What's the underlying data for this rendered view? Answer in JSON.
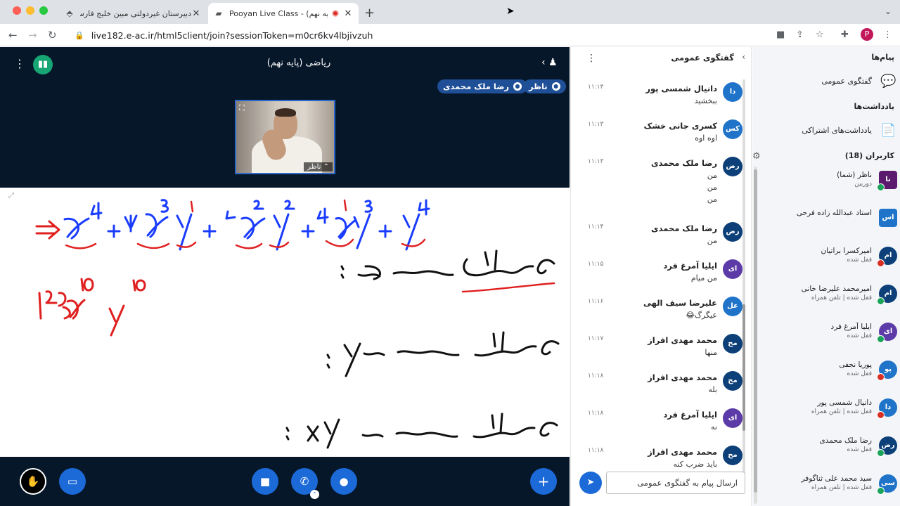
{
  "browser": {
    "tabs": [
      {
        "title": "دبیرستان غیردولتی مبین خلیج فارس",
        "active": false
      },
      {
        "title": "Pooyan Live Class - (پایه نهم)",
        "active": true
      }
    ],
    "url": "live182.e-ac.ir/html5client/join?sessionToken=m0cr6kv4lbjivzuh",
    "profile_initial": "P"
  },
  "stage": {
    "meeting_title": "ریاضی (پایه نهم)",
    "talkers": [
      "ناظر",
      "رضا ملک محمدی"
    ],
    "webcam_name": "ناظر"
  },
  "chat": {
    "title": "گفتگوی عمومی",
    "input_placeholder": "ارسال پیام به گفتگوی عمومی",
    "messages": [
      {
        "initials": "دا",
        "sender": "دانیال شمسی پور",
        "time": "۱۱:۱۳",
        "lines": [
          "ببخشید"
        ],
        "color": "#1f73c9"
      },
      {
        "initials": "کس",
        "sender": "کسری جانی خشک",
        "time": "۱۱:۱۳",
        "lines": [
          "اوه اوه"
        ],
        "color": "#1f73c9"
      },
      {
        "initials": "رض",
        "sender": "رضا ملک محمدی",
        "time": "۱۱:۱۳",
        "lines": [
          "من",
          "من",
          "من"
        ],
        "color": "#0d3f78"
      },
      {
        "initials": "رض",
        "sender": "رضا ملک محمدی",
        "time": "۱۱:۱۴",
        "lines": [
          "من"
        ],
        "color": "#0d3f78"
      },
      {
        "initials": "ای",
        "sender": "ایلیا آمرغ فرد",
        "time": "۱۱:۱۵",
        "lines": [
          "من میام"
        ],
        "color": "#5c3aa8"
      },
      {
        "initials": "عل",
        "sender": "علیرضا سیف الهی",
        "time": "۱۱:۱۶",
        "lines": [
          "عیگرگ😂"
        ],
        "color": "#1f73c9"
      },
      {
        "initials": "مح",
        "sender": "محمد مهدی افراز",
        "time": "۱۱:۱۷",
        "lines": [
          "منها"
        ],
        "color": "#0d3f78"
      },
      {
        "initials": "مح",
        "sender": "محمد مهدی افراز",
        "time": "۱۱:۱۸",
        "lines": [
          "بله"
        ],
        "color": "#0d3f78"
      },
      {
        "initials": "ای",
        "sender": "ایلیا آمرغ فرد",
        "time": "۱۱:۱۸",
        "lines": [
          "نه"
        ],
        "color": "#5c3aa8"
      },
      {
        "initials": "مح",
        "sender": "محمد مهدی افراز",
        "time": "۱۱:۱۸",
        "lines": [
          "باید ضرب کنه"
        ],
        "color": "#0d3f78"
      }
    ]
  },
  "users_panel": {
    "messages_title": "پیام‌ها",
    "public_chat_label": "گفتگوی عمومی",
    "notes_title": "یادداشت‌ها",
    "shared_notes_label": "یادداشت‌های اشتراکی",
    "users_title": "کاربران (18)",
    "users": [
      {
        "initials": "نا",
        "name": "ناظر (شما)",
        "sub": "دوربین",
        "color": "#5b1a6e",
        "status": "#1aa35a",
        "square": true
      },
      {
        "initials": "اس",
        "name": "استاد عبدالله زاده فرحی",
        "sub": "",
        "color": "#1f73c9",
        "status": "",
        "square": true
      },
      {
        "initials": "ام",
        "name": "امیرکسرا براتیان",
        "sub": "قفل شده",
        "color": "#0d3f78",
        "status": "#d93025",
        "square": false
      },
      {
        "initials": "ام",
        "name": "امیرمحمد علیرضا خانی",
        "sub": "قفل شده | تلفن همراه",
        "color": "#0d3f78",
        "status": "#1aa35a",
        "square": false
      },
      {
        "initials": "ای",
        "name": "ایلیا آمرغ فرد",
        "sub": "قفل شده",
        "color": "#5c3aa8",
        "status": "#1aa35a",
        "square": false
      },
      {
        "initials": "پو",
        "name": "پوریا نجفی",
        "sub": "قفل شده",
        "color": "#1f73c9",
        "status": "#d93025",
        "square": false
      },
      {
        "initials": "دا",
        "name": "دانیال شمسی پور",
        "sub": "قفل شده | تلفن همراه",
        "color": "#1f73c9",
        "status": "#d93025",
        "square": false
      },
      {
        "initials": "رض",
        "name": "رضا ملک محمدی",
        "sub": "قفل شده",
        "color": "#0d3f78",
        "status": "#1aa35a",
        "square": false
      },
      {
        "initials": "سی",
        "name": "سید محمد علی ثناگوفر",
        "sub": "قفل شده | تلفن همراه",
        "color": "#1f73c9",
        "status": "#1aa35a",
        "square": false
      }
    ]
  }
}
